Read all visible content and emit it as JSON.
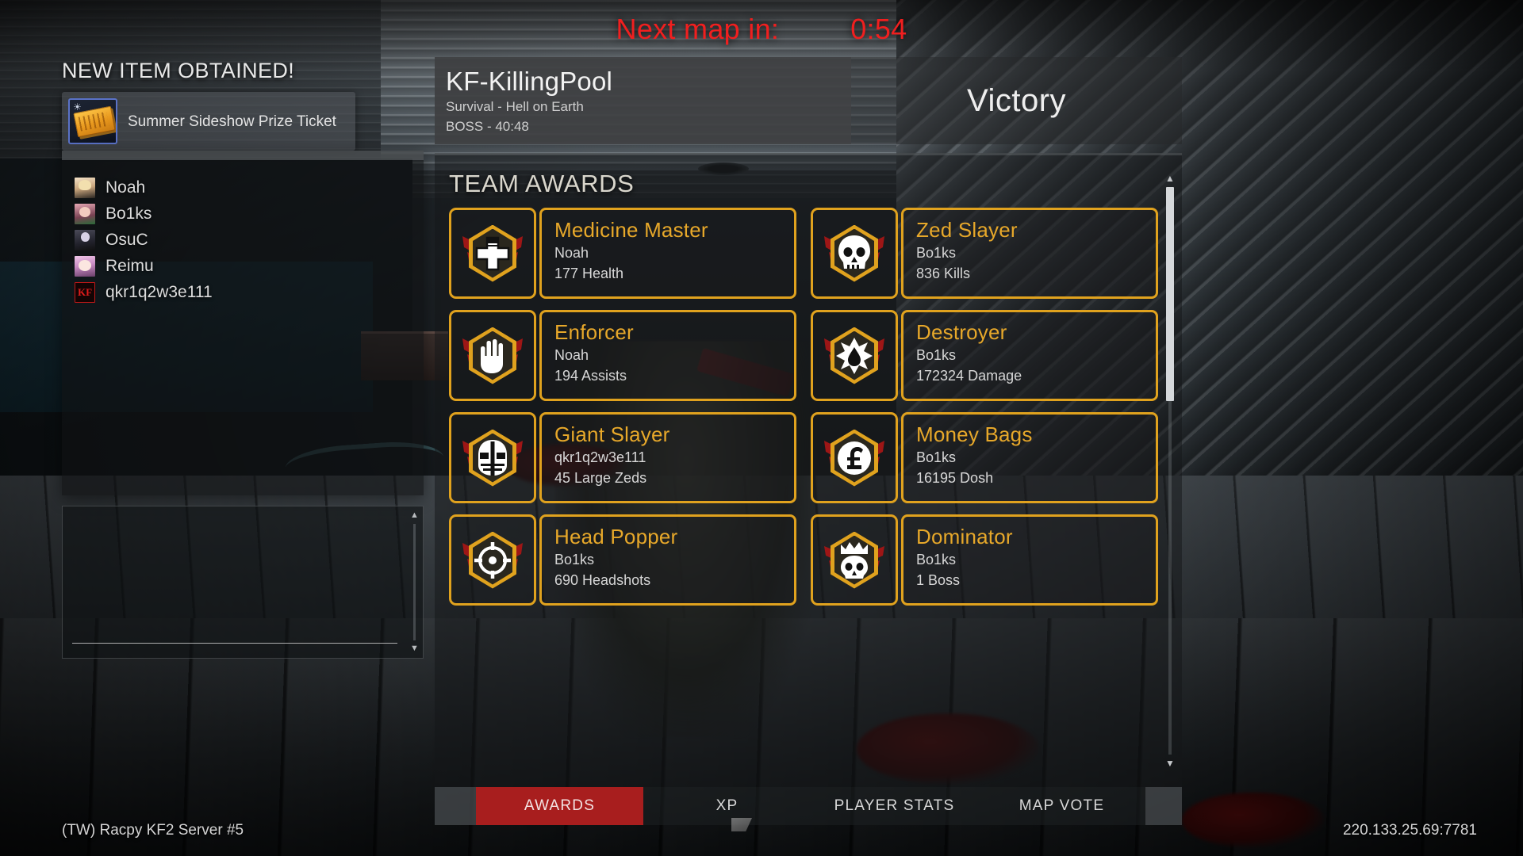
{
  "timer": {
    "label": "Next map in:",
    "value": "0:54"
  },
  "item_toast": {
    "heading": "NEW ITEM OBTAINED!",
    "item_name": "Summer Sideshow Prize Ticket",
    "icon": "ticket-icon",
    "star_glyph": "☀"
  },
  "players": {
    "items": [
      {
        "name": "Noah",
        "avatar": "avatar-anime-blonde"
      },
      {
        "name": "Bo1ks",
        "avatar": "avatar-anime-pink"
      },
      {
        "name": "OsuC",
        "avatar": "avatar-anime-dark"
      },
      {
        "name": "Reimu",
        "avatar": "avatar-anime-purple"
      },
      {
        "name": "qkr1q2w3e111",
        "avatar": "avatar-kf2-logo",
        "logo_text": "KF"
      }
    ]
  },
  "map_info": {
    "name": "KF-KillingPool",
    "mode": "Survival - Hell on Earth",
    "boss_line": "BOSS - 40:48"
  },
  "result": {
    "label": "Victory"
  },
  "awards": {
    "title": "TEAM AWARDS",
    "items": [
      {
        "name": "Medicine Master",
        "player": "Noah",
        "stat": "177 Health",
        "icon": "medic-cross-icon"
      },
      {
        "name": "Zed Slayer",
        "player": "Bo1ks",
        "stat": "836 Kills",
        "icon": "skull-icon"
      },
      {
        "name": "Enforcer",
        "player": "Noah",
        "stat": "194 Assists",
        "icon": "open-hand-icon"
      },
      {
        "name": "Destroyer",
        "player": "Bo1ks",
        "stat": "172324 Damage",
        "icon": "explosion-drop-icon"
      },
      {
        "name": "Giant Slayer",
        "player": "qkr1q2w3e111",
        "stat": "45 Large Zeds",
        "icon": "fleshpound-skull-icon"
      },
      {
        "name": "Money Bags",
        "player": "Bo1ks",
        "stat": "16195 Dosh",
        "icon": "dosh-icon"
      },
      {
        "name": "Head Popper",
        "player": "Bo1ks",
        "stat": "690 Headshots",
        "icon": "crosshair-icon"
      },
      {
        "name": "Dominator",
        "player": "Bo1ks",
        "stat": "1 Boss",
        "icon": "crowned-skull-icon"
      }
    ]
  },
  "tabs": {
    "items": [
      {
        "label": "AWARDS",
        "active": true
      },
      {
        "label": "XP",
        "active": false
      },
      {
        "label": "PLAYER STATS",
        "active": false
      },
      {
        "label": "MAP VOTE",
        "active": false
      }
    ]
  },
  "footer": {
    "server_name": "(TW) Racpy KF2 Server #5",
    "server_address": "220.133.25.69:7781"
  },
  "colors": {
    "award_gold": "#e0a21e",
    "award_name": "#e7a82a",
    "timer_red": "#f01f1f",
    "tab_active_red": "#a81e1e",
    "wing_red": "#9e1616"
  },
  "scroll": {
    "up_glyph": "▲",
    "down_glyph": "▼"
  }
}
